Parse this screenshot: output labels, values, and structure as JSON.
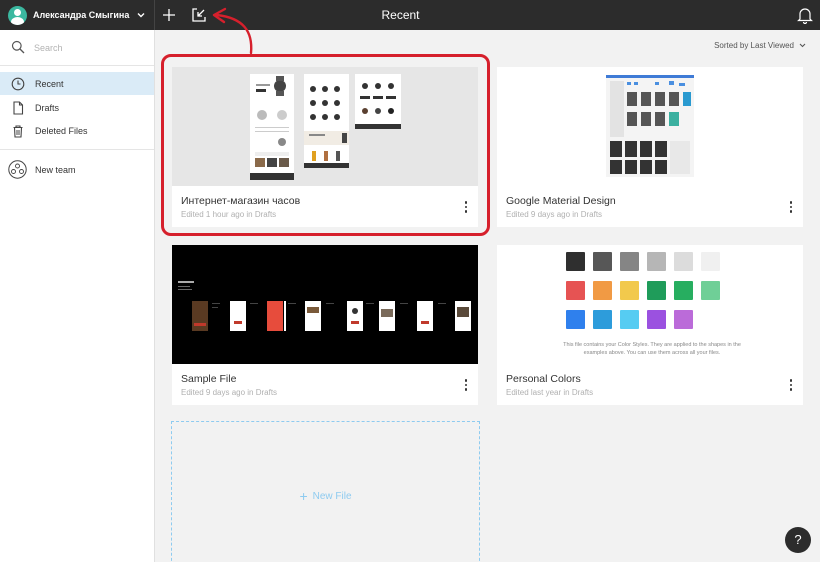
{
  "header": {
    "username": "Александра Смыгина",
    "title": "Recent",
    "chevron_icon": "chevron-down-icon",
    "add_icon": "plus-icon",
    "import_icon": "import-icon",
    "notifications_icon": "bell-icon"
  },
  "sidebar": {
    "search_placeholder": "Search",
    "items": [
      {
        "label": "Recent",
        "icon": "clock-icon",
        "active": true
      },
      {
        "label": "Drafts",
        "icon": "file-icon",
        "active": false
      },
      {
        "label": "Deleted Files",
        "icon": "trash-icon",
        "active": false
      }
    ],
    "team": {
      "label": "New team",
      "icon": "team-icon"
    }
  },
  "main": {
    "sort_label": "Sorted by Last Viewed",
    "files": [
      {
        "name": "Интернет-магазин часов",
        "meta": "Edited 1 hour ago in Drafts"
      },
      {
        "name": "Google Material Design",
        "meta": "Edited 9 days ago in Drafts"
      },
      {
        "name": "Sample File",
        "meta": "Edited 9 days ago in Drafts"
      },
      {
        "name": "Personal Colors",
        "meta": "Edited last year in Drafts"
      }
    ],
    "personal_colors_caption": "This file contains your Color Styles. They are applied to the shapes in the examples above. You can use them across all your files.",
    "swatch_colors": [
      [
        "#2f2f2f",
        "#575757",
        "#858585",
        "#b6b6b6",
        "#dcdcdc",
        "#f0f0f0"
      ],
      [
        "#e65353",
        "#f19a44",
        "#f2c94c",
        "#1f9c5a",
        "#27ae60",
        "#6fcf97"
      ],
      [
        "#2f80ed",
        "#2d9cdb",
        "#56ccf2",
        "#9b51e0",
        "#bb6bd9"
      ]
    ],
    "new_file_label": "New File"
  },
  "help_label": "?",
  "annotation_color": "#d6202c"
}
